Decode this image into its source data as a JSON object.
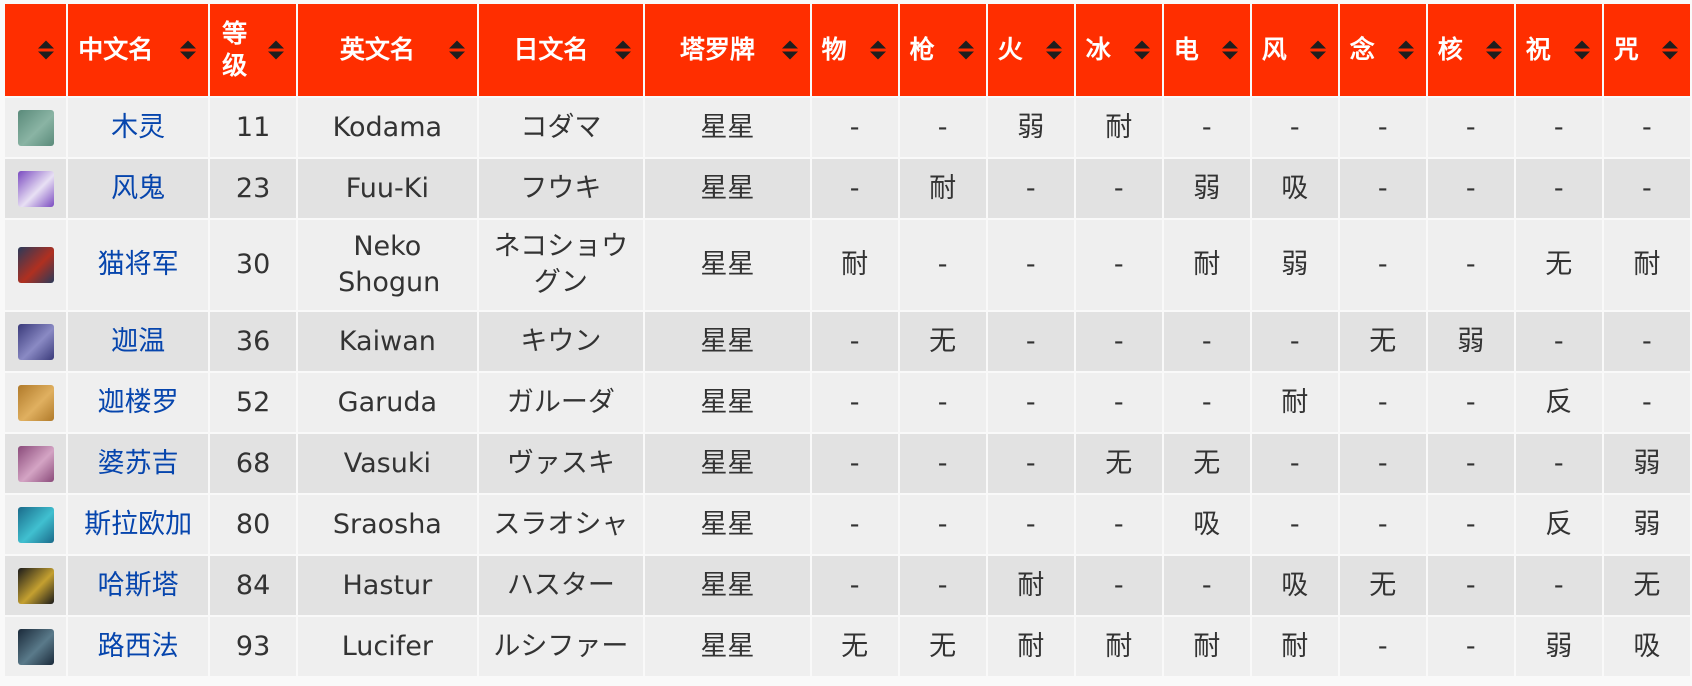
{
  "headers": {
    "icon": "",
    "cn_name": "中文名",
    "level": "等级",
    "en_name": "英文名",
    "jp_name": "日文名",
    "arcana": "塔罗牌",
    "phys": "物",
    "gun": "枪",
    "fire": "火",
    "ice": "冰",
    "elec": "电",
    "wind": "风",
    "psy": "念",
    "nuke": "核",
    "bless": "祝",
    "curse": "咒"
  },
  "rows": [
    {
      "icon": "kodama-icon",
      "cn": "木灵",
      "lv": "11",
      "en": "Kodama",
      "jp": "コダマ",
      "arcana": "星星",
      "r": [
        "-",
        "-",
        "弱",
        "耐",
        "-",
        "-",
        "-",
        "-",
        "-",
        "-"
      ],
      "colors": [
        "#5a8a7a",
        "#8ab4a4"
      ]
    },
    {
      "icon": "fuu-ki-icon",
      "cn": "风鬼",
      "lv": "23",
      "en": "Fuu-Ki",
      "jp": "フウキ",
      "arcana": "星星",
      "r": [
        "-",
        "耐",
        "-",
        "-",
        "弱",
        "吸",
        "-",
        "-",
        "-",
        "-"
      ],
      "colors": [
        "#7a4ac0",
        "#e8e0f4"
      ]
    },
    {
      "icon": "neko-shogun-icon",
      "cn": "猫将军",
      "lv": "30",
      "en": "Neko Shogun",
      "jp": "ネコショウグン",
      "arcana": "星星",
      "r": [
        "耐",
        "-",
        "-",
        "-",
        "耐",
        "弱",
        "-",
        "-",
        "无",
        "耐"
      ],
      "colors": [
        "#2a3a5a",
        "#b03020"
      ]
    },
    {
      "icon": "kaiwan-icon",
      "cn": "迦温",
      "lv": "36",
      "en": "Kaiwan",
      "jp": "キウン",
      "arcana": "星星",
      "r": [
        "-",
        "无",
        "-",
        "-",
        "-",
        "-",
        "无",
        "弱",
        "-",
        "-"
      ],
      "colors": [
        "#3a3a7a",
        "#8a8ac4"
      ]
    },
    {
      "icon": "garuda-icon",
      "cn": "迦楼罗",
      "lv": "52",
      "en": "Garuda",
      "jp": "ガルーダ",
      "arcana": "星星",
      "r": [
        "-",
        "-",
        "-",
        "-",
        "-",
        "耐",
        "-",
        "-",
        "反",
        "-"
      ],
      "colors": [
        "#b07a2a",
        "#e0b060"
      ]
    },
    {
      "icon": "vasuki-icon",
      "cn": "婆苏吉",
      "lv": "68",
      "en": "Vasuki",
      "jp": "ヴァスキ",
      "arcana": "星星",
      "r": [
        "-",
        "-",
        "-",
        "无",
        "无",
        "-",
        "-",
        "-",
        "-",
        "弱"
      ],
      "colors": [
        "#8a4a7a",
        "#d4a4c4"
      ]
    },
    {
      "icon": "sraosha-icon",
      "cn": "斯拉欧加",
      "lv": "80",
      "en": "Sraosha",
      "jp": "スラオシャ",
      "arcana": "星星",
      "r": [
        "-",
        "-",
        "-",
        "-",
        "吸",
        "-",
        "-",
        "-",
        "反",
        "弱"
      ],
      "colors": [
        "#1a6a8a",
        "#40c0d0"
      ]
    },
    {
      "icon": "hastur-icon",
      "cn": "哈斯塔",
      "lv": "84",
      "en": "Hastur",
      "jp": "ハスター",
      "arcana": "星星",
      "r": [
        "-",
        "-",
        "耐",
        "-",
        "-",
        "吸",
        "无",
        "-",
        "-",
        "无"
      ],
      "colors": [
        "#1a1a1a",
        "#c4a030"
      ]
    },
    {
      "icon": "lucifer-icon",
      "cn": "路西法",
      "lv": "93",
      "en": "Lucifer",
      "jp": "ルシファー",
      "arcana": "星星",
      "r": [
        "无",
        "无",
        "耐",
        "耐",
        "耐",
        "耐",
        "-",
        "-",
        "弱",
        "吸"
      ],
      "colors": [
        "#1a2a3a",
        "#5a7a8a"
      ]
    }
  ]
}
